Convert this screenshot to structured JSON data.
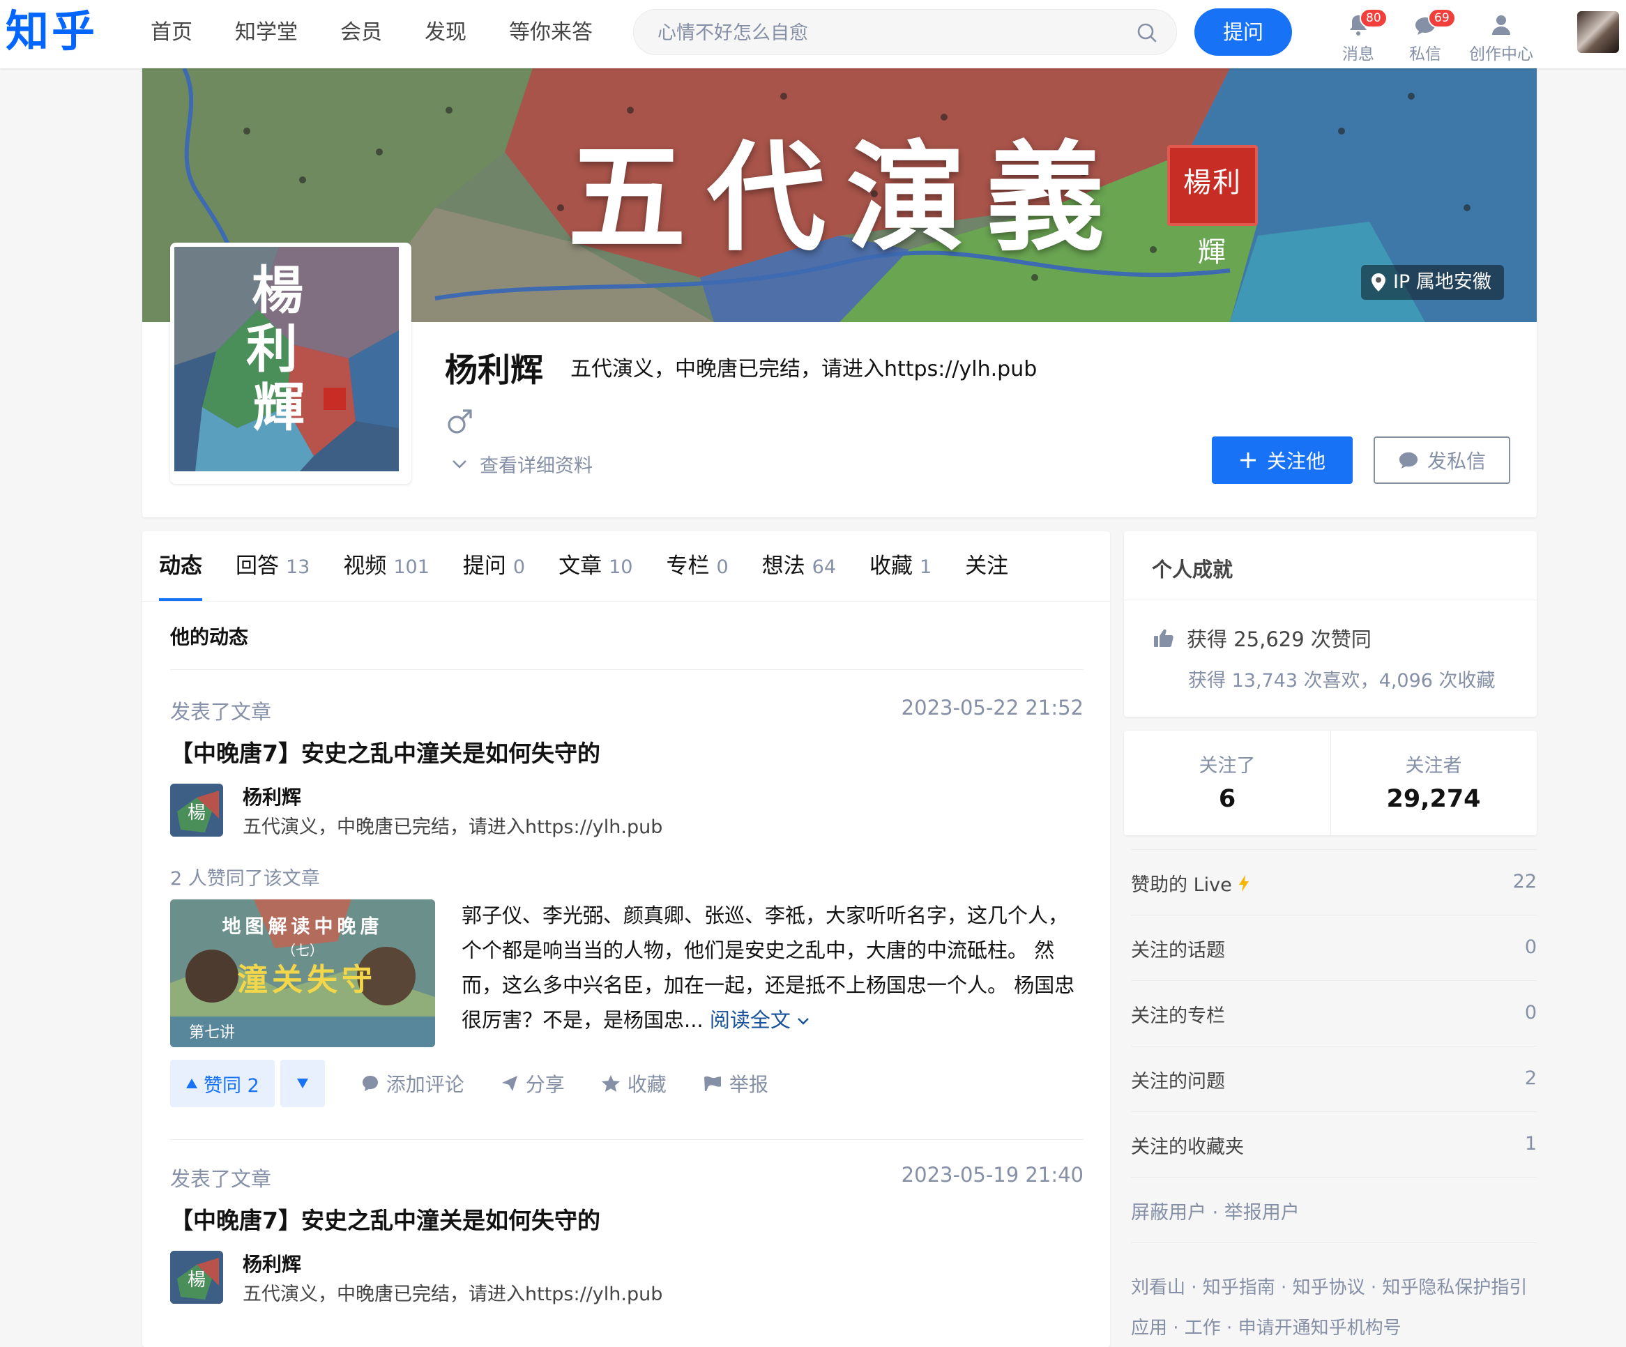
{
  "topbar": {
    "logo": "知乎",
    "nav": [
      "首页",
      "知学堂",
      "会员",
      "发现",
      "等你来答"
    ],
    "search_placeholder": "心情不好怎么自愈",
    "ask_label": "提问",
    "messages_label": "消息",
    "messages_badge": "80",
    "chats_label": "私信",
    "chats_badge": "69",
    "creator_label": "创作中心"
  },
  "profile": {
    "cover_title": "五代演義",
    "cover_seal": "楊利輝",
    "ip_location": "IP 属地安徽",
    "avatar_text": "楊利輝",
    "name": "杨利辉",
    "headline": "五代演义，中晚唐已完结，请进入https://ylh.pub",
    "gender_symbol": "♂",
    "detail_link": "查看详细资料",
    "follow_label": "关注他",
    "message_label": "发私信"
  },
  "tabs": [
    {
      "label": "动态",
      "count": ""
    },
    {
      "label": "回答",
      "count": "13"
    },
    {
      "label": "视频",
      "count": "101"
    },
    {
      "label": "提问",
      "count": "0"
    },
    {
      "label": "文章",
      "count": "10"
    },
    {
      "label": "专栏",
      "count": "0"
    },
    {
      "label": "想法",
      "count": "64"
    },
    {
      "label": "收藏",
      "count": "1"
    },
    {
      "label": "关注",
      "count": ""
    }
  ],
  "activity": {
    "section_title": "他的动态",
    "items": [
      {
        "action": "发表了文章",
        "time": "2023-05-22 21:52",
        "title": "【中晚唐7】安史之乱中潼关是如何失守的",
        "author": "杨利辉",
        "author_headline": "五代演义，中晚唐已完结，请进入https://ylh.pub",
        "liked_by": "2 人赞同了该文章",
        "thumb_title": "地图解读中晚唐",
        "thumb_sub": "（七）",
        "thumb_main": "潼关失守",
        "thumb_episode": "第七讲",
        "excerpt": "郭子仪、李光弼、颜真卿、张巡、李祗，大家听听名字，这几个人，个个都是响当当的人物，他们是安史之乱中，大唐的中流砥柱。 然而，这么多中兴名臣，加在一起，还是抵不上杨国忠一个人。 杨国忠很厉害？不是，是杨国忠...",
        "read_more": "阅读全文",
        "vote_label": "赞同 2",
        "comment_label": "添加评论",
        "share_label": "分享",
        "collect_label": "收藏",
        "report_label": "举报"
      },
      {
        "action": "发表了文章",
        "time": "2023-05-19 21:40",
        "title": "【中晚唐7】安史之乱中潼关是如何失守的",
        "author": "杨利辉",
        "author_headline": "五代演义，中晚唐已完结，请进入https://ylh.pub"
      }
    ]
  },
  "sidebar": {
    "achievements_title": "个人成就",
    "likes_line": "获得 25,629 次赞同",
    "likes_sub": "获得 13,743 次喜欢，4,096 次收藏",
    "following_label": "关注了",
    "following_count": "6",
    "followers_label": "关注者",
    "followers_count": "29,274",
    "rows": [
      {
        "label": "赞助的 Live",
        "value": "22"
      },
      {
        "label": "关注的话题",
        "value": "0"
      },
      {
        "label": "关注的专栏",
        "value": "0"
      },
      {
        "label": "关注的问题",
        "value": "2"
      },
      {
        "label": "关注的收藏夹",
        "value": "1"
      }
    ],
    "block_report": "屏蔽用户 · 举报用户",
    "footer_line1": "刘看山 · 知乎指南 · 知乎协议 · 知乎隐私保护指引",
    "footer_line2": "应用 · 工作 · 申请开通知乎机构号"
  },
  "colors": {
    "brand": "#1772f6",
    "badge": "#f1403c",
    "muted": "#8590a6"
  }
}
